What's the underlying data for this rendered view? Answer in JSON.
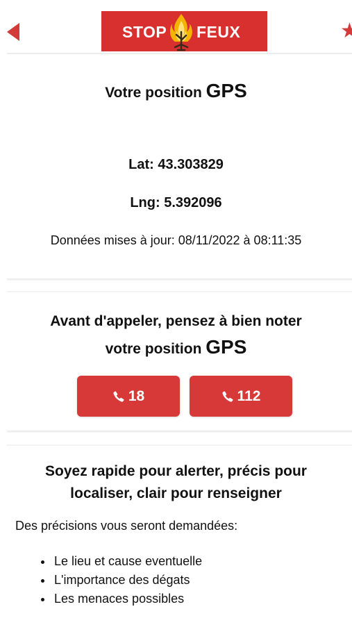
{
  "header": {
    "logo_left": "STOP",
    "logo_right": "FEUX",
    "back_icon": "chevron-left-icon",
    "star_icon": "star-icon",
    "logo_color": "#d8302f"
  },
  "position": {
    "title": "Votre position",
    "title_gps": "GPS",
    "lat": "Lat: 43.303829",
    "lng": "Lng: 5.392096",
    "updated": "Données mises à jour: 08/11/2022 à 08:11:35"
  },
  "call": {
    "title_line1": "Avant d'appeler, pensez à bien noter",
    "title_line2": "votre position",
    "title_gps": "GPS",
    "buttons": [
      {
        "label": "18",
        "icon": "phone-icon"
      },
      {
        "label": "112",
        "icon": "phone-icon"
      }
    ],
    "button_color": "#d73838"
  },
  "advice": {
    "title_line1": "Soyez rapide pour alerter, précis pour",
    "title_line2": "localiser, clair pour renseigner",
    "intro": "Des précisions vous seront demandées:",
    "items": [
      "Le lieu et cause eventuelle",
      "L'importance des dégats",
      "Les menaces possibles"
    ]
  }
}
